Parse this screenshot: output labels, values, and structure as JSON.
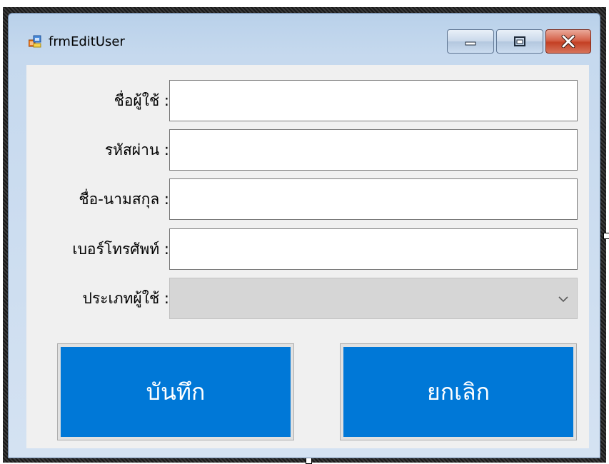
{
  "window": {
    "title": "frmEditUser"
  },
  "form": {
    "fields": [
      {
        "label": "ชื่อผู้ใช้ :",
        "value": "",
        "kind": "textbox"
      },
      {
        "label": "รหัสผ่าน :",
        "value": "",
        "kind": "textbox"
      },
      {
        "label": "ชื่อ-นามสกุล :",
        "value": "",
        "kind": "textbox"
      },
      {
        "label": "เบอร์โทรศัพท์ :",
        "value": "",
        "kind": "textbox"
      },
      {
        "label": "ประเภทผู้ใช้ :",
        "value": "",
        "kind": "combobox"
      }
    ],
    "buttons": {
      "save_label": "บันทึก",
      "cancel_label": "ยกเลิก"
    }
  },
  "colors": {
    "button_accent": "#0078d7",
    "client_background": "#f0f0f0",
    "combo_disabled": "#d6d6d6"
  },
  "icons": {
    "app": "form-app-icon",
    "minimize": "minimize-icon",
    "maximize": "maximize-icon",
    "close": "close-icon",
    "combo": "chevron-down-icon"
  }
}
